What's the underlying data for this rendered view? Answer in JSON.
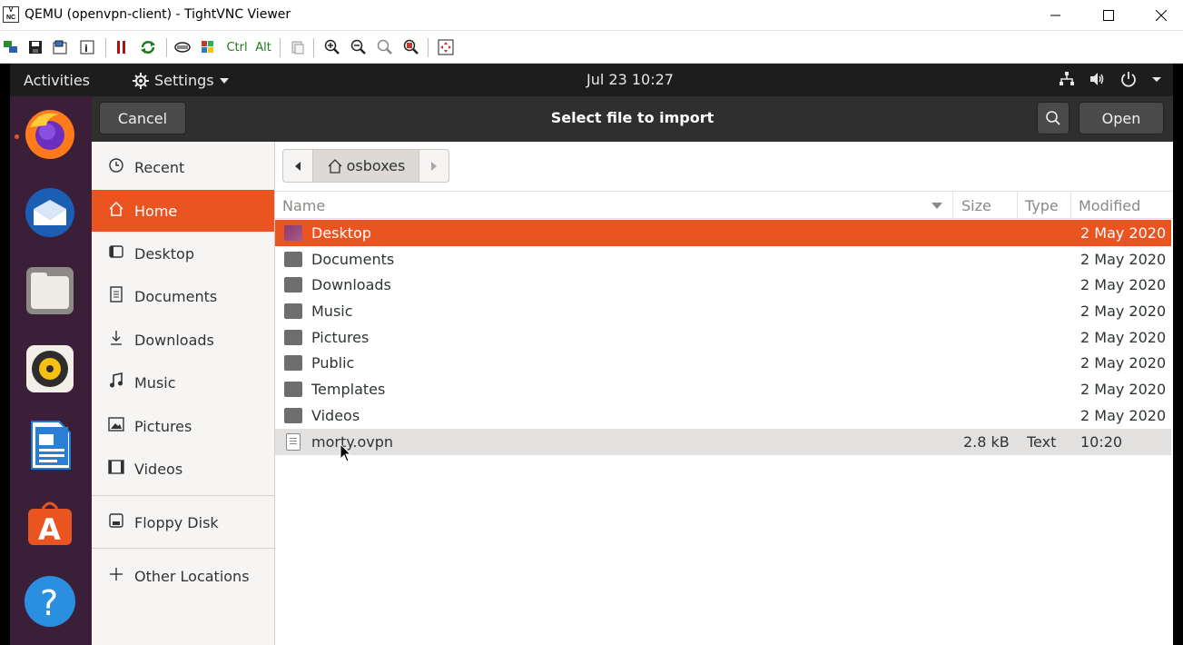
{
  "window": {
    "title": "QEMU (openvpn-client) - TightVNC Viewer",
    "controls": {
      "minimize": "—",
      "maximize": "☐",
      "close": "✕"
    }
  },
  "vnc_toolbar": {
    "ctrl_label": "Ctrl",
    "alt_label": "Alt",
    "icons": [
      "new-connection-icon",
      "save-icon",
      "options-icon",
      "info-icon",
      "pause-icon",
      "refresh-icon",
      "ctrl-alt-del-icon",
      "ctrl-esc-icon",
      "clipboard-icon",
      "zoom-in-icon",
      "zoom-out-icon",
      "zoom-100-icon",
      "zoom-fit-icon",
      "fullscreen-icon"
    ]
  },
  "topbar": {
    "activities": "Activities",
    "settings": "Settings",
    "clock": "Jul 23  10:27"
  },
  "dock": {
    "apps": [
      "firefox",
      "thunderbird",
      "files",
      "rhythmbox",
      "libreoffice-writer",
      "ubuntu-software",
      "help"
    ]
  },
  "dialog": {
    "title": "Select file to import",
    "cancel_label": "Cancel",
    "open_label": "Open"
  },
  "sidebar": {
    "items": [
      {
        "label": "Recent",
        "icon": "clock-icon"
      },
      {
        "label": "Home",
        "icon": "home-icon"
      },
      {
        "label": "Desktop",
        "icon": "desktop-icon"
      },
      {
        "label": "Documents",
        "icon": "documents-icon"
      },
      {
        "label": "Downloads",
        "icon": "downloads-icon"
      },
      {
        "label": "Music",
        "icon": "music-icon"
      },
      {
        "label": "Pictures",
        "icon": "pictures-icon"
      },
      {
        "label": "Videos",
        "icon": "videos-icon"
      }
    ],
    "floppy": "Floppy Disk",
    "other": "Other Locations"
  },
  "pathbar": {
    "crumb": "osboxes"
  },
  "columns": {
    "name": "Name",
    "size": "Size",
    "type": "Type",
    "modified": "Modified"
  },
  "files": [
    {
      "name": "Desktop",
      "size": "",
      "type": "",
      "modified": "2 May 2020"
    },
    {
      "name": "Documents",
      "size": "",
      "type": "",
      "modified": "2 May 2020"
    },
    {
      "name": "Downloads",
      "size": "",
      "type": "",
      "modified": "2 May 2020"
    },
    {
      "name": "Music",
      "size": "",
      "type": "",
      "modified": "2 May 2020"
    },
    {
      "name": "Pictures",
      "size": "",
      "type": "",
      "modified": "2 May 2020"
    },
    {
      "name": "Public",
      "size": "",
      "type": "",
      "modified": "2 May 2020"
    },
    {
      "name": "Templates",
      "size": "",
      "type": "",
      "modified": "2 May 2020"
    },
    {
      "name": "Videos",
      "size": "",
      "type": "",
      "modified": "2 May 2020"
    },
    {
      "name": "morty.ovpn",
      "size": "2.8 kB",
      "type": "Text",
      "modified": "10:20"
    }
  ],
  "colors": {
    "accent": "#e95420",
    "dock_bg": "#3b1f38",
    "header_bg": "#2f2f2f",
    "topbar_bg": "#1d1d1d"
  }
}
